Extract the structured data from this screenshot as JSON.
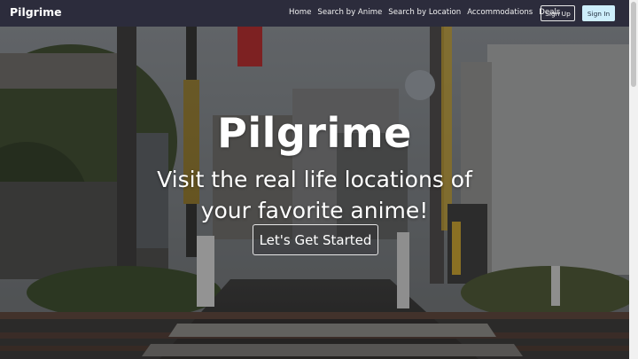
{
  "navbar": {
    "brand": "Pilgrime",
    "links": [
      "Home",
      "Search by Anime",
      "Search by Location",
      "Accommodations",
      "Deals"
    ],
    "signup_label": "Sign Up",
    "signin_label": "Sign In"
  },
  "hero": {
    "title": "Pilgrime",
    "subtitle": "Visit the real life locations of your favorite anime!",
    "cta_label": "Let's Get Started"
  },
  "colors": {
    "navbar_bg": "#2c2c3c",
    "signin_bg": "#cdeefb",
    "text": "#ffffff"
  }
}
